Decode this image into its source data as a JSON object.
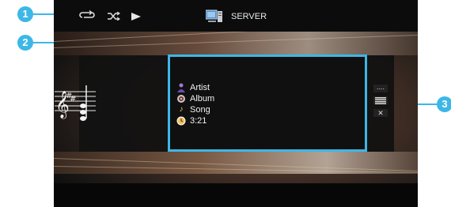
{
  "callouts": [
    "1",
    "2",
    "3"
  ],
  "header": {
    "source_label": "SERVER",
    "icons": [
      "repeat-icon",
      "shuffle-icon",
      "play-icon",
      "server-icon"
    ]
  },
  "now_playing": {
    "artist": "Artist",
    "album": "Album",
    "song": "Song",
    "time": "3:21",
    "icons": [
      "artist-icon",
      "album-icon",
      "song-icon",
      "time-icon"
    ]
  },
  "side_controls": {
    "items": [
      "more-icon",
      "list-icon",
      "close-icon"
    ],
    "more_label": "....",
    "close_label": "✕"
  },
  "colors": {
    "accent": "#3db7e6"
  }
}
